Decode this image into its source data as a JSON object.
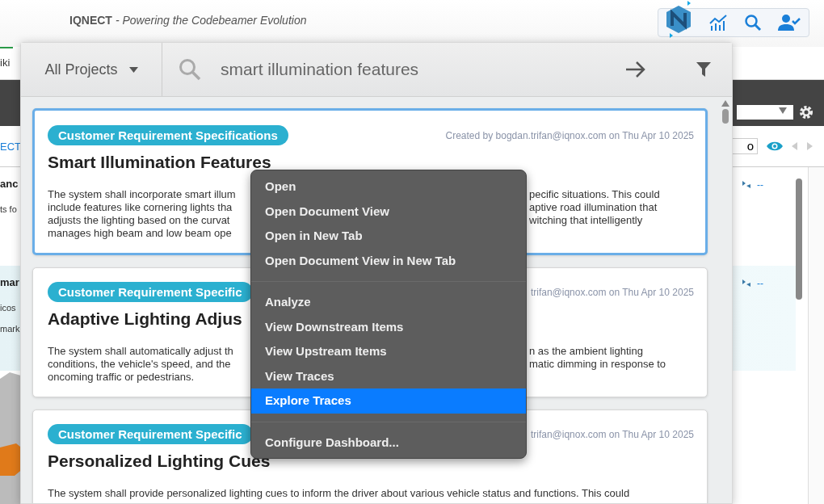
{
  "header": {
    "brand": "IQNECT",
    "tagline": "- Powering the Codebeamer Evolution"
  },
  "background": {
    "nav_tab": "iki",
    "breadcrumb": "ECT",
    "filter_value": "o",
    "rows": [
      {
        "heading": "anc",
        "lines": [
          "ts fo"
        ],
        "value": "--",
        "selected": false
      },
      {
        "heading": "mar",
        "lines": [
          "icos",
          "mark"
        ],
        "value": "--",
        "selected": true
      }
    ]
  },
  "search": {
    "scope": "All Projects",
    "query": "smart illumination features"
  },
  "results": [
    {
      "badge": "Customer Requirement Specifications",
      "title": "Smart Illumination Features",
      "meta": "Created by bogdan.trifan@iqnox.com on Thu Apr 10 2025",
      "selected": true,
      "lines": [
        {
          "left": "The system shall incorporate smart illum",
          "right": "pecific situations. This could"
        },
        {
          "left": "include features like cornering lights tha",
          "right": "aptive road illumination that"
        },
        {
          "left": "adjusts the lighting based on the curvat",
          "right": "witching that intelligently"
        },
        {
          "left": "manages high beam and low beam ope"
        }
      ]
    },
    {
      "badge": "Customer Requirement Specific",
      "title": "Adaptive Lighting Adjus",
      "meta": "trifan@iqnox.com on Thu Apr 10 2025",
      "selected": false,
      "lines": [
        {
          "left": "The system shall automatically adjust th",
          "right": "n as the ambient lighting"
        },
        {
          "left": "conditions, the vehicle's speed, and the",
          "right": "matic dimming in response to"
        },
        {
          "left": "oncoming traffic or pedestrians."
        }
      ]
    },
    {
      "badge": "Customer Requirement Specific",
      "title": "Personalized Lighting Cues",
      "meta": "trifan@iqnox.com on Thu Apr 10 2025",
      "selected": false,
      "lines": [
        {
          "left": "The system shall provide personalized lighting cues to inform the driver about various vehicle status and functions. This could"
        }
      ]
    }
  ],
  "context_menu": {
    "groups": [
      [
        {
          "label": "Open",
          "selected": false
        },
        {
          "label": "Open Document View",
          "selected": false
        },
        {
          "label": "Open in New Tab",
          "selected": false
        },
        {
          "label": "Open Document View in New Tab",
          "selected": false
        }
      ],
      [
        {
          "label": "Analyze",
          "selected": false
        },
        {
          "label": "View Downstream Items",
          "selected": false
        },
        {
          "label": "View Upstream Items",
          "selected": false
        },
        {
          "label": "View Traces",
          "selected": false
        },
        {
          "label": "Explore Traces",
          "selected": true
        }
      ],
      [
        {
          "label": "Configure Dashboard...",
          "selected": false
        }
      ]
    ]
  }
}
